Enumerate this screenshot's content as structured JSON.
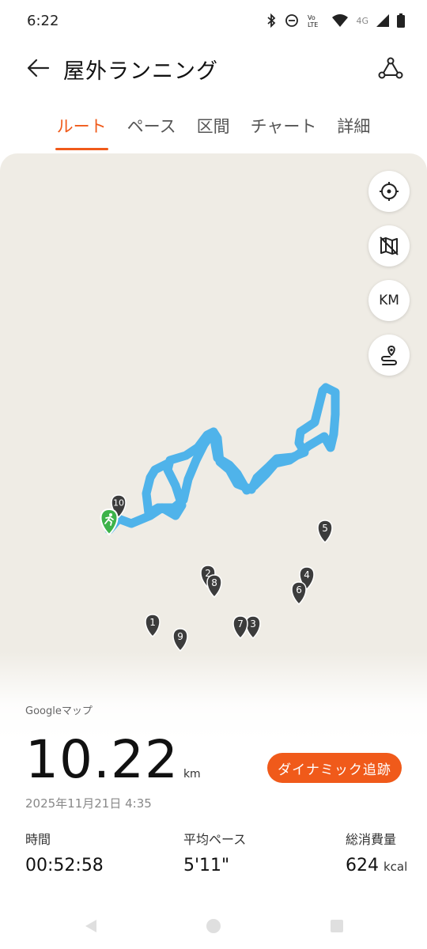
{
  "status": {
    "time": "6:22",
    "network": "4G"
  },
  "header": {
    "title": "屋外ランニング"
  },
  "tabs": [
    {
      "label": "ルート",
      "active": true
    },
    {
      "label": "ペース",
      "active": false
    },
    {
      "label": "区間",
      "active": false
    },
    {
      "label": "チャート",
      "active": false
    },
    {
      "label": "詳細",
      "active": false
    }
  ],
  "map": {
    "controls": {
      "km_label": "KM"
    },
    "route_color": "#4fb3ea",
    "markers": [
      "1",
      "2",
      "3",
      "4",
      "5",
      "6",
      "7",
      "8",
      "9",
      "10"
    ],
    "attribution": "Googleマップ"
  },
  "summary": {
    "distance": "10.22",
    "distance_unit": "km",
    "dynamic_button": "ダイナミック追跡",
    "date": "2025年11月21日 4:35",
    "stats": [
      {
        "label": "時間",
        "value": "00:52:58",
        "unit": ""
      },
      {
        "label": "平均ペース",
        "value": "5'11\"",
        "unit": ""
      },
      {
        "label": "総消費量",
        "value": "624",
        "unit": "kcal"
      }
    ]
  },
  "colors": {
    "accent": "#f05a1a",
    "map_bg": "#efece5",
    "marker": "#3c3c3c",
    "start_marker": "#3db34a"
  }
}
